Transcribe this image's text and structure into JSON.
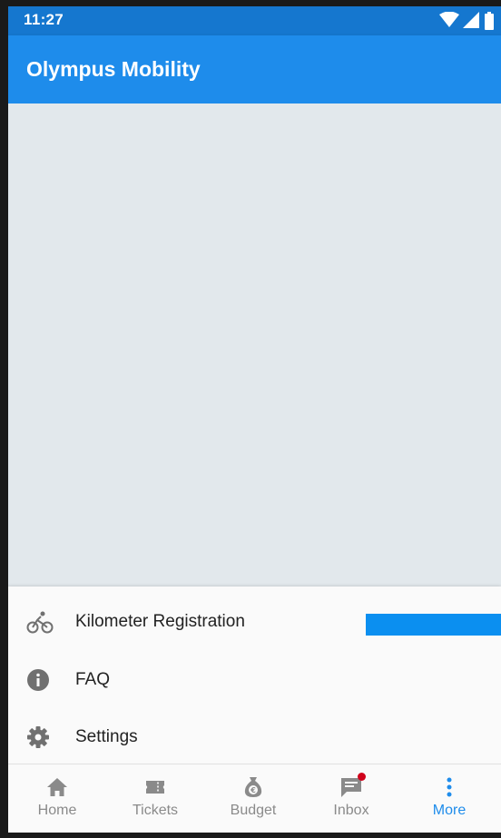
{
  "status_bar": {
    "time": "11:27",
    "icons": [
      "wifi-icon",
      "cellular-signal-icon",
      "battery-icon"
    ]
  },
  "app_bar": {
    "title": "Olympus Mobility"
  },
  "menu": {
    "items": [
      {
        "label": "Kilometer Registration",
        "icon": "bicycle-icon"
      },
      {
        "label": "FAQ",
        "icon": "info-icon"
      },
      {
        "label": "Settings",
        "icon": "gear-icon"
      }
    ],
    "progress_fraction": 1.0
  },
  "bottom_nav": {
    "items": [
      {
        "label": "Home",
        "icon": "home-icon",
        "active": false
      },
      {
        "label": "Tickets",
        "icon": "ticket-icon",
        "active": false
      },
      {
        "label": "Budget",
        "icon": "money-bag-icon",
        "active": false
      },
      {
        "label": "Inbox",
        "icon": "message-icon",
        "active": false,
        "badge": true
      },
      {
        "label": "More",
        "icon": "more-vertical-icon",
        "active": true
      }
    ]
  },
  "colors": {
    "status_bar": "#1577cf",
    "app_bar": "#1e8ceb",
    "content_background": "#e2e8ec",
    "progress": "#0b8ff0",
    "active_nav": "#1e8ceb",
    "inactive_nav": "#8a8a8a",
    "badge": "#d0021b"
  }
}
